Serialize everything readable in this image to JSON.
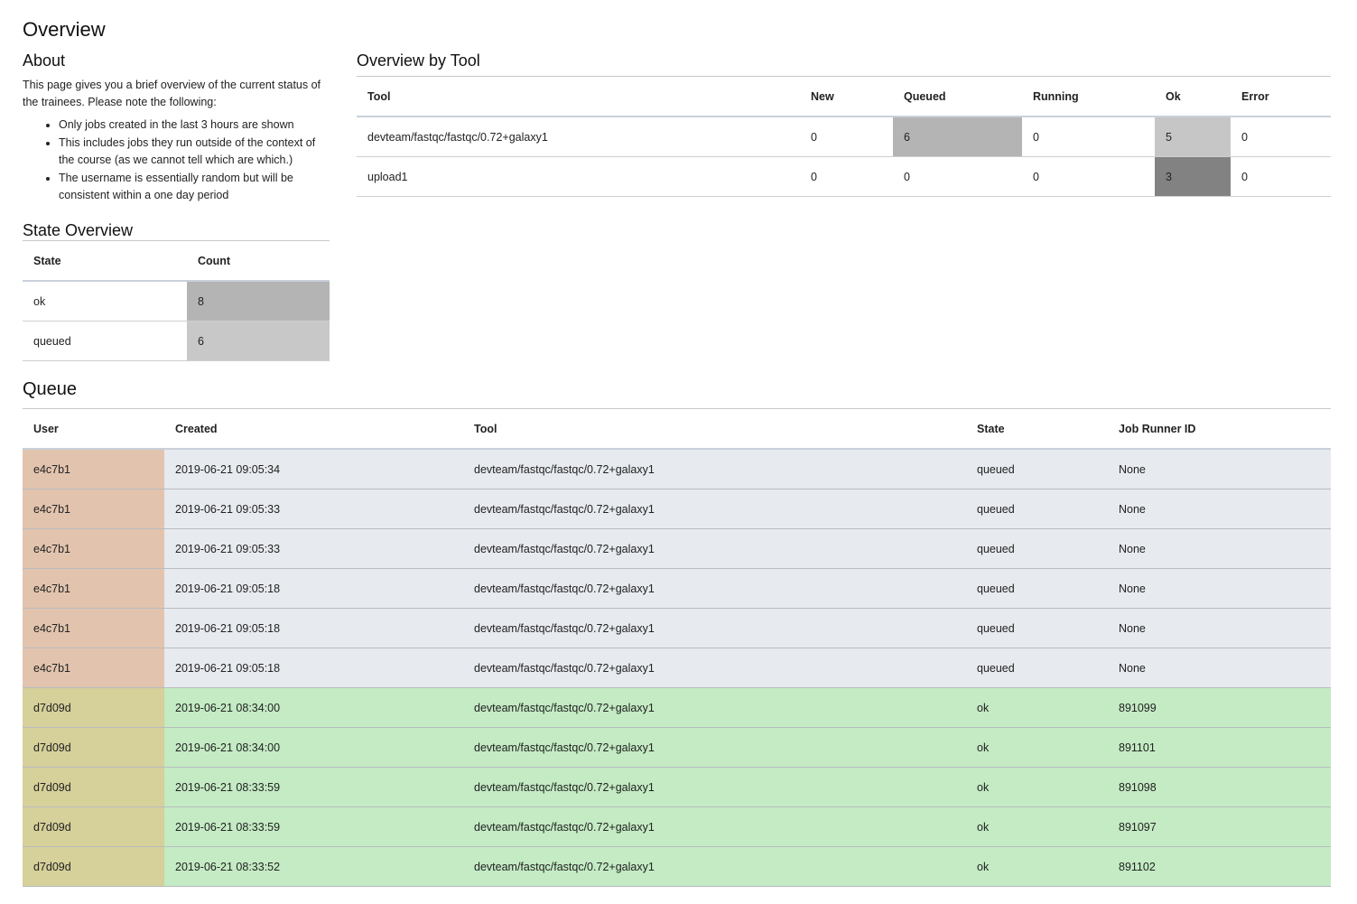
{
  "page_title": "Overview",
  "about": {
    "title": "About",
    "text": "This page gives you a brief overview of the current status of the trainees. Please note the following:",
    "notes": [
      "Only jobs created in the last 3 hours are shown",
      "This includes jobs they run outside of the context of the course (as we cannot tell which are which.)",
      "The username is essentially random but will be consistent within a one day period"
    ]
  },
  "state_overview": {
    "title": "State Overview",
    "headers": [
      "State",
      "Count"
    ],
    "rows": [
      {
        "state": "ok",
        "count": "8",
        "shade": "#b4b4b4"
      },
      {
        "state": "queued",
        "count": "6",
        "shade": "#c8c8c8"
      }
    ]
  },
  "tool_overview": {
    "title": "Overview by Tool",
    "headers": [
      "Tool",
      "New",
      "Queued",
      "Running",
      "Ok",
      "Error"
    ],
    "rows": [
      {
        "tool": "devteam/fastqc/fastqc/0.72+galaxy1",
        "cells": [
          {
            "value": "0",
            "shade": ""
          },
          {
            "value": "6",
            "shade": "#b4b4b4"
          },
          {
            "value": "0",
            "shade": ""
          },
          {
            "value": "5",
            "shade": "#c6c6c6"
          },
          {
            "value": "0",
            "shade": ""
          }
        ]
      },
      {
        "tool": "upload1",
        "cells": [
          {
            "value": "0",
            "shade": ""
          },
          {
            "value": "0",
            "shade": ""
          },
          {
            "value": "0",
            "shade": ""
          },
          {
            "value": "3",
            "shade": "#828282"
          },
          {
            "value": "0",
            "shade": ""
          }
        ]
      }
    ]
  },
  "queue": {
    "title": "Queue",
    "headers": [
      "User",
      "Created",
      "Tool",
      "State",
      "Job Runner ID"
    ],
    "rows": [
      {
        "user": "e4c7b1",
        "created": "2019-06-21 09:05:34",
        "tool": "devteam/fastqc/fastqc/0.72+galaxy1",
        "state": "queued",
        "runner": "None"
      },
      {
        "user": "e4c7b1",
        "created": "2019-06-21 09:05:33",
        "tool": "devteam/fastqc/fastqc/0.72+galaxy1",
        "state": "queued",
        "runner": "None"
      },
      {
        "user": "e4c7b1",
        "created": "2019-06-21 09:05:33",
        "tool": "devteam/fastqc/fastqc/0.72+galaxy1",
        "state": "queued",
        "runner": "None"
      },
      {
        "user": "e4c7b1",
        "created": "2019-06-21 09:05:18",
        "tool": "devteam/fastqc/fastqc/0.72+galaxy1",
        "state": "queued",
        "runner": "None"
      },
      {
        "user": "e4c7b1",
        "created": "2019-06-21 09:05:18",
        "tool": "devteam/fastqc/fastqc/0.72+galaxy1",
        "state": "queued",
        "runner": "None"
      },
      {
        "user": "e4c7b1",
        "created": "2019-06-21 09:05:18",
        "tool": "devteam/fastqc/fastqc/0.72+galaxy1",
        "state": "queued",
        "runner": "None"
      },
      {
        "user": "d7d09d",
        "created": "2019-06-21 08:34:00",
        "tool": "devteam/fastqc/fastqc/0.72+galaxy1",
        "state": "ok",
        "runner": "891099"
      },
      {
        "user": "d7d09d",
        "created": "2019-06-21 08:34:00",
        "tool": "devteam/fastqc/fastqc/0.72+galaxy1",
        "state": "ok",
        "runner": "891101"
      },
      {
        "user": "d7d09d",
        "created": "2019-06-21 08:33:59",
        "tool": "devteam/fastqc/fastqc/0.72+galaxy1",
        "state": "ok",
        "runner": "891098"
      },
      {
        "user": "d7d09d",
        "created": "2019-06-21 08:33:59",
        "tool": "devteam/fastqc/fastqc/0.72+galaxy1",
        "state": "ok",
        "runner": "891097"
      },
      {
        "user": "d7d09d",
        "created": "2019-06-21 08:33:52",
        "tool": "devteam/fastqc/fastqc/0.72+galaxy1",
        "state": "ok",
        "runner": "891102"
      }
    ]
  }
}
